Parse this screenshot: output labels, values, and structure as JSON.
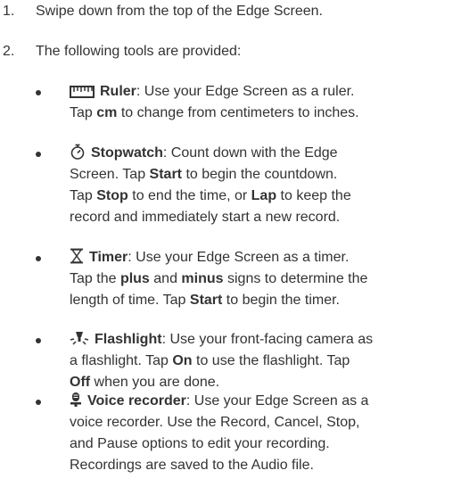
{
  "steps": [
    {
      "number": "1.",
      "text": "Swipe down from the top of the Edge Screen."
    },
    {
      "number": "2.",
      "text": "The following tools are provided:"
    }
  ],
  "tools": [
    {
      "icon": "ruler-icon",
      "name": "Ruler",
      "sentences": [
        {
          "parts": [
            {
              "t": ": Use your Edge Screen as a ruler."
            }
          ]
        },
        {
          "parts": [
            {
              "t": "Tap "
            },
            {
              "t": "cm",
              "b": true
            },
            {
              "t": " to change from centimeters to inches."
            }
          ]
        }
      ]
    },
    {
      "icon": "stopwatch-icon",
      "name": "Stopwatch",
      "sentences": [
        {
          "parts": [
            {
              "t": ": Count down with the Edge"
            }
          ]
        },
        {
          "parts": [
            {
              "t": "Screen. Tap "
            },
            {
              "t": "Start",
              "b": true
            },
            {
              "t": " to begin the countdown."
            }
          ]
        },
        {
          "parts": [
            {
              "t": "Tap "
            },
            {
              "t": "Stop",
              "b": true
            },
            {
              "t": " to end the time, or "
            },
            {
              "t": "Lap",
              "b": true
            },
            {
              "t": " to keep the"
            }
          ]
        },
        {
          "parts": [
            {
              "t": "record and immediately start a new record."
            }
          ]
        }
      ]
    },
    {
      "icon": "hourglass-icon",
      "name": "Timer",
      "sentences": [
        {
          "parts": [
            {
              "t": ": Use your Edge Screen as a timer."
            }
          ]
        },
        {
          "parts": [
            {
              "t": "Tap the "
            },
            {
              "t": "plus",
              "b": true
            },
            {
              "t": " and "
            },
            {
              "t": "minus",
              "b": true
            },
            {
              "t": " signs to determine the"
            }
          ]
        },
        {
          "parts": [
            {
              "t": "length of time. Tap "
            },
            {
              "t": "Start",
              "b": true
            },
            {
              "t": " to begin the timer."
            }
          ]
        }
      ]
    },
    {
      "icon": "flashlight-icon",
      "name": "Flashlight",
      "sentences": [
        {
          "parts": [
            {
              "t": ": Use your front-facing camera as"
            }
          ]
        },
        {
          "parts": [
            {
              "t": "a flashlight. Tap "
            },
            {
              "t": "On",
              "b": true
            },
            {
              "t": " to use the flashlight. Tap"
            }
          ]
        },
        {
          "parts": [
            {
              "t": "Off",
              "b": true
            },
            {
              "t": " when you are done."
            }
          ]
        }
      ]
    },
    {
      "icon": "microphone-icon",
      "name": "Voice recorder",
      "sentences": [
        {
          "parts": [
            {
              "t": ": Use your Edge Screen as a"
            }
          ]
        },
        {
          "parts": [
            {
              "t": "voice recorder. Use the Record, Cancel, Stop,"
            }
          ]
        },
        {
          "parts": [
            {
              "t": "and Pause options to edit your recording."
            }
          ]
        },
        {
          "parts": [
            {
              "t": "Recordings are saved to the Audio file."
            }
          ]
        }
      ]
    }
  ]
}
